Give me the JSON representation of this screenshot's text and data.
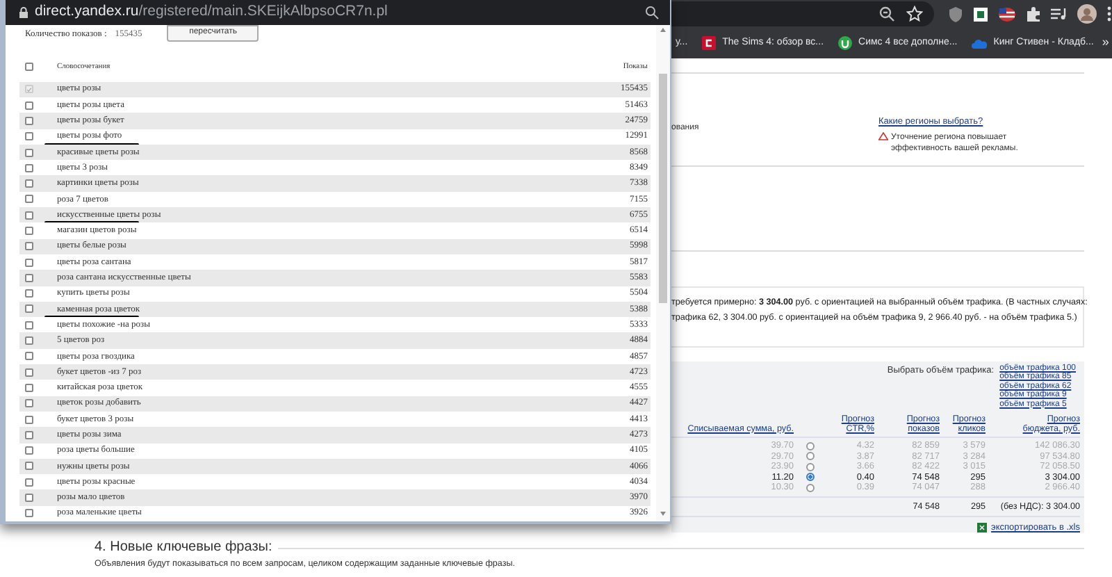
{
  "browser": {
    "bookmarks": [
      {
        "kind": "text",
        "label": "у..."
      },
      {
        "kind": "red-square",
        "label": "The Sims 4: обзор вс..."
      },
      {
        "kind": "green-circle",
        "label": "Симс 4 все дополне..."
      },
      {
        "kind": "blue-cloud",
        "label": "Кинг Стивен - Кладб..."
      }
    ],
    "more": "»"
  },
  "page": {
    "region": {
      "cut_text": "ования",
      "link": "Какие регионы выбрать?",
      "warning": "Уточнение региона повышает эффективность вашей рекламы."
    },
    "budget_note": [
      "требуется примерно: **3 304.00** руб. с ориентацией на выбранный объём трафика. (В частных случаях:",
      "трафика 62, 3 304.00 руб. с ориентацией на объём трафика 9, 2 966.40 руб. - на объём трафика 5.)"
    ],
    "traffic": {
      "label": "Выбрать объём трафика:",
      "options": [
        "объём трафика 100",
        "объём трафика 85",
        "объём трафика 62",
        "объём трафика 9",
        "объём трафика 5"
      ]
    },
    "forecast": {
      "columns": [
        "Списываемая сумма, руб.",
        "Прогноз CTR,%",
        "Прогноз показов",
        "Прогноз кликов",
        "Прогноз бюджета, руб."
      ],
      "rows": [
        {
          "cost": "39.70",
          "selected": false,
          "ctr": "4.32",
          "impressions": "82 859",
          "clicks": "3 579",
          "budget": "142 086.30"
        },
        {
          "cost": "29.70",
          "selected": false,
          "ctr": "3.87",
          "impressions": "82 717",
          "clicks": "3 284",
          "budget": "97 534.80"
        },
        {
          "cost": "23.90",
          "selected": false,
          "ctr": "3.66",
          "impressions": "82 422",
          "clicks": "3 015",
          "budget": "72 058.50"
        },
        {
          "cost": "11.20",
          "selected": true,
          "ctr": "0.40",
          "impressions": "74 548",
          "clicks": "295",
          "budget": "3 304.00"
        },
        {
          "cost": "10.30",
          "selected": false,
          "ctr": "0.39",
          "impressions": "74 047",
          "clicks": "288",
          "budget": "2 966.40"
        }
      ],
      "totals": {
        "impressions": "74 548",
        "clicks": "295",
        "budget": "(без НДС): 3 304.00"
      },
      "export": "экспортировать в .xls"
    },
    "section": {
      "title": "4. Новые ключевые фразы:",
      "text": "Объявления будут показываться по всем запросам, целиком содержащим заданные ключевые фразы."
    }
  },
  "popup": {
    "url_host": "direct.yandex.ru",
    "url_path": "/registered/main.SKEijkAlbpsoCR7n.pl",
    "count_label": "Количество показов :",
    "count": "155435",
    "recount_button": "пересчитать",
    "columns": [
      "Словосочетания",
      "Показы"
    ],
    "select_all_checked": false,
    "rows": [
      {
        "phrase": "цветы розы",
        "count": "155435",
        "checked": true,
        "disabled": true,
        "underlined": false
      },
      {
        "phrase": "цветы розы цвета",
        "count": "51463",
        "checked": false,
        "disabled": false,
        "underlined": false
      },
      {
        "phrase": "цветы розы букет",
        "count": "24759",
        "checked": false,
        "disabled": false,
        "underlined": false
      },
      {
        "phrase": "цветы розы фото",
        "count": "12991",
        "checked": false,
        "disabled": false,
        "underlined": true
      },
      {
        "phrase": "красивые цветы розы",
        "count": "8568",
        "checked": false,
        "disabled": false,
        "underlined": false
      },
      {
        "phrase": "цветы 3 розы",
        "count": "8349",
        "checked": false,
        "disabled": false,
        "underlined": false
      },
      {
        "phrase": "картинки цветы розы",
        "count": "7338",
        "checked": false,
        "disabled": false,
        "underlined": false
      },
      {
        "phrase": "роза 7 цветов",
        "count": "7155",
        "checked": false,
        "disabled": false,
        "underlined": false
      },
      {
        "phrase": "искусственные цветы розы",
        "count": "6755",
        "checked": false,
        "disabled": false,
        "underlined": true
      },
      {
        "phrase": "магазин цветов розы",
        "count": "6514",
        "checked": false,
        "disabled": false,
        "underlined": false
      },
      {
        "phrase": "цветы белые розы",
        "count": "5998",
        "checked": false,
        "disabled": false,
        "underlined": false
      },
      {
        "phrase": "цветы роза сантана",
        "count": "5817",
        "checked": false,
        "disabled": false,
        "underlined": false
      },
      {
        "phrase": "роза сантана искусственные цветы",
        "count": "5583",
        "checked": false,
        "disabled": false,
        "underlined": false
      },
      {
        "phrase": "купить цветы розы",
        "count": "5504",
        "checked": false,
        "disabled": false,
        "underlined": false
      },
      {
        "phrase": "каменная роза цветок",
        "count": "5388",
        "checked": false,
        "disabled": false,
        "underlined": true
      },
      {
        "phrase": "цветы похожие -на розы",
        "count": "5333",
        "checked": false,
        "disabled": false,
        "underlined": false
      },
      {
        "phrase": "5 цветов роз",
        "count": "4884",
        "checked": false,
        "disabled": false,
        "underlined": false
      },
      {
        "phrase": "цветы роза гвоздика",
        "count": "4857",
        "checked": false,
        "disabled": false,
        "underlined": false
      },
      {
        "phrase": "букет цветов -из 7 роз",
        "count": "4723",
        "checked": false,
        "disabled": false,
        "underlined": false
      },
      {
        "phrase": "китайская роза цветок",
        "count": "4555",
        "checked": false,
        "disabled": false,
        "underlined": false
      },
      {
        "phrase": "цветок розы добавить",
        "count": "4427",
        "checked": false,
        "disabled": false,
        "underlined": false
      },
      {
        "phrase": "букет цветов 3 розы",
        "count": "4413",
        "checked": false,
        "disabled": false,
        "underlined": false
      },
      {
        "phrase": "цветы розы зима",
        "count": "4273",
        "checked": false,
        "disabled": false,
        "underlined": false
      },
      {
        "phrase": "роза цветы большие",
        "count": "4105",
        "checked": false,
        "disabled": false,
        "underlined": false
      },
      {
        "phrase": "нужны цветы розы",
        "count": "4066",
        "checked": false,
        "disabled": false,
        "underlined": false
      },
      {
        "phrase": "цветы розы красные",
        "count": "4034",
        "checked": false,
        "disabled": false,
        "underlined": false
      },
      {
        "phrase": "розы мало цветов",
        "count": "3970",
        "checked": false,
        "disabled": false,
        "underlined": false
      },
      {
        "phrase": "роза маленькие цветы",
        "count": "3926",
        "checked": false,
        "disabled": false,
        "underlined": false
      }
    ]
  }
}
